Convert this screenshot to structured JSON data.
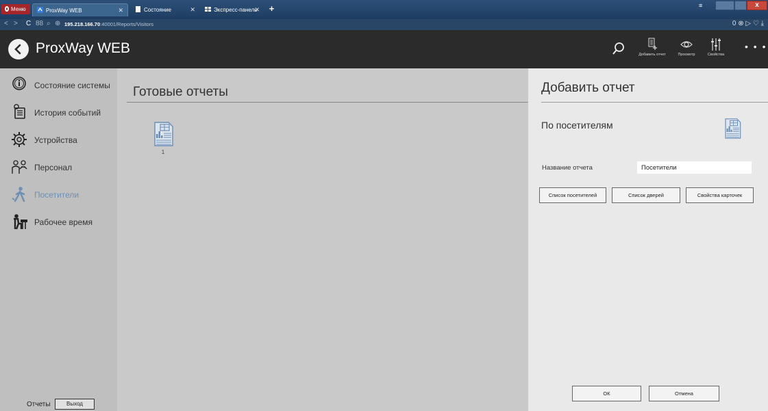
{
  "browser": {
    "menu_label": "Меню",
    "tabs": [
      {
        "title": "ProxWay WEB"
      },
      {
        "title": "Состояние системы.pdf"
      },
      {
        "title": "Экспресс-панель"
      }
    ],
    "new_tab": "+",
    "url_host": "195.218.166.70",
    "url_rest": ":40001/Reports/Visitors",
    "addr_right": "0 ⊗ ▷ ♡   ⤓"
  },
  "header": {
    "title": "ProxWay WEB",
    "actions": [
      {
        "label": "Добавить отчет",
        "icon": "add-report-icon"
      },
      {
        "label": "Просмотр",
        "icon": "eye-icon"
      },
      {
        "label": "Свойства",
        "icon": "sliders-icon"
      }
    ],
    "more": "• • •"
  },
  "sidebar": {
    "items": [
      {
        "label": "Состояние системы",
        "icon": "info-circle-icon"
      },
      {
        "label": "История событий",
        "icon": "event-history-icon"
      },
      {
        "label": "Устройства",
        "icon": "gear-icon"
      },
      {
        "label": "Персонал",
        "icon": "personnel-icon"
      },
      {
        "label": "Посетители",
        "icon": "visitor-icon",
        "active": true
      },
      {
        "label": "Рабочее время",
        "icon": "working-time-icon"
      }
    ],
    "footer": {
      "reports": "Отчеты",
      "exit": "Выход"
    }
  },
  "main": {
    "title": "Готовые отчеты",
    "reports": [
      {
        "caption": "1",
        "icon": "report-icon"
      }
    ]
  },
  "panel": {
    "title": "Добавить отчет",
    "subtitle": "По посетителям",
    "name_label": "Название отчета",
    "name_value": "Посетители",
    "buttons": {
      "visitors": "Список посетителей",
      "doors": "Список дверей",
      "card_props": "Свойства карточек",
      "ok": "ОК",
      "cancel": "Отмена"
    }
  },
  "colors": {
    "header_bg": "#2b2b2b",
    "sidebar_bg": "#bfbfbf",
    "main_bg": "#c9c9c9",
    "panel_bg": "#e9e9e9",
    "accent": "#6e8fb2",
    "report_icon": "#5f86b3"
  }
}
